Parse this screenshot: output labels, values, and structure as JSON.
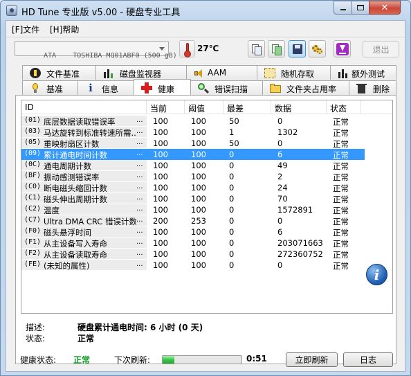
{
  "window": {
    "title": "HD Tune 专业版 v5.00 - 硬盘专业工具"
  },
  "menu": {
    "file": "[F]文件",
    "help": "[H]帮助"
  },
  "toolbar": {
    "drive": "ATA    TOSHIBA MQ01ABF0 (500 gB)",
    "temperature": "27℃",
    "exit_label": "退出"
  },
  "tabs_top": [
    {
      "label": "文件基准",
      "icon": "file-benchmark-icon"
    },
    {
      "label": "磁盘监视器",
      "icon": "disk-monitor-icon"
    },
    {
      "label": "AAM",
      "icon": "speaker-icon"
    },
    {
      "label": "随机存取",
      "icon": "random-access-icon"
    },
    {
      "label": "额外测试",
      "icon": "extra-tests-icon"
    }
  ],
  "tabs_bottom": [
    {
      "label": "基准",
      "icon": "lightbulb-icon"
    },
    {
      "label": "信息",
      "icon": "info-icon"
    },
    {
      "label": "健康",
      "icon": "red-cross-icon",
      "selected": true
    },
    {
      "label": "错误扫描",
      "icon": "magnifier-icon"
    },
    {
      "label": "文件夹占用率",
      "icon": "folder-icon"
    },
    {
      "label": "删除",
      "icon": "trash-icon"
    }
  ],
  "smart_table": {
    "headers": [
      "ID",
      "当前",
      "阈值",
      "最差",
      "数据",
      "状态"
    ],
    "rows": [
      {
        "code": "(01)",
        "name": "底层数据读取错误率",
        "current": "100",
        "threshold": "100",
        "worst": "50",
        "data": "0",
        "status": "正常"
      },
      {
        "code": "(03)",
        "name": "马达旋转到标准转速所需...",
        "current": "100",
        "threshold": "100",
        "worst": "1",
        "data": "1302",
        "status": "正常"
      },
      {
        "code": "(05)",
        "name": "重映射扇区计数",
        "current": "100",
        "threshold": "100",
        "worst": "50",
        "data": "0",
        "status": "正常"
      },
      {
        "code": "(09)",
        "name": "累计通电时间计数",
        "current": "100",
        "threshold": "100",
        "worst": "0",
        "data": "6",
        "status": "正常",
        "selected": true
      },
      {
        "code": "(0C)",
        "name": "通电周期计数",
        "current": "100",
        "threshold": "100",
        "worst": "0",
        "data": "49",
        "status": "正常"
      },
      {
        "code": "(BF)",
        "name": "振动感测错误率",
        "current": "100",
        "threshold": "100",
        "worst": "0",
        "data": "2",
        "status": "正常"
      },
      {
        "code": "(C0)",
        "name": "断电磁头缩回计数",
        "current": "100",
        "threshold": "100",
        "worst": "0",
        "data": "24",
        "status": "正常"
      },
      {
        "code": "(C1)",
        "name": "磁头伸出周期计数",
        "current": "100",
        "threshold": "100",
        "worst": "0",
        "data": "70",
        "status": "正常"
      },
      {
        "code": "(C2)",
        "name": "温度",
        "current": "100",
        "threshold": "100",
        "worst": "0",
        "data": "1572891",
        "status": "正常"
      },
      {
        "code": "(C7)",
        "name": "Ultra DMA CRC 错误计数",
        "current": "200",
        "threshold": "253",
        "worst": "0",
        "data": "0",
        "status": "正常"
      },
      {
        "code": "(F0)",
        "name": "磁头悬浮时间",
        "current": "100",
        "threshold": "100",
        "worst": "0",
        "data": "6",
        "status": "正常"
      },
      {
        "code": "(F1)",
        "name": "从主设备写入寿命",
        "current": "100",
        "threshold": "100",
        "worst": "0",
        "data": "203071663",
        "status": "正常"
      },
      {
        "code": "(F2)",
        "name": "从主设备读取寿命",
        "current": "100",
        "threshold": "100",
        "worst": "0",
        "data": "272360752",
        "status": "正常"
      },
      {
        "code": "(FE)",
        "name": "(未知的属性)",
        "current": "100",
        "threshold": "100",
        "worst": "0",
        "data": "0",
        "status": "正常"
      }
    ],
    "dots": "..."
  },
  "details": {
    "desc_label": "描述:",
    "desc_value": "硬盘累计通电时间: 6 小时 (0 天)",
    "status_label": "状态:",
    "status_value": "正常"
  },
  "footer": {
    "health_label": "健康状态:",
    "health_value": "正常",
    "refresh_label": "下次刷新:",
    "refresh_progress": 0.15,
    "countdown": "0:51",
    "refresh_button": "立即刷新",
    "log_button": "日志"
  },
  "colors": {
    "selection": "#3399ff",
    "health_ok": "#139a26",
    "close_button": "#c9473a"
  }
}
